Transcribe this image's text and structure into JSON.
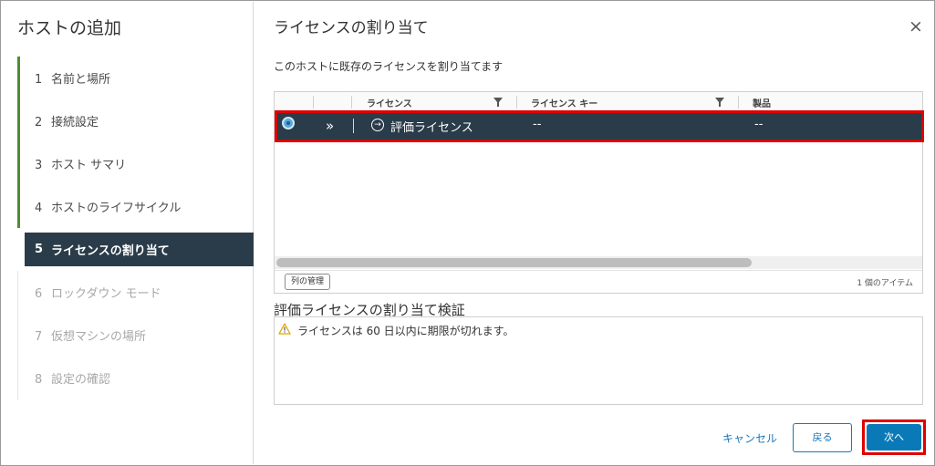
{
  "wizard": {
    "title": "ホストの追加",
    "steps": [
      {
        "num": "1",
        "label": "名前と場所",
        "state": "done"
      },
      {
        "num": "2",
        "label": "接続設定",
        "state": "done"
      },
      {
        "num": "3",
        "label": "ホスト サマリ",
        "state": "done"
      },
      {
        "num": "4",
        "label": "ホストのライフサイクル",
        "state": "done"
      },
      {
        "num": "5",
        "label": "ライセンスの割り当て",
        "state": "active"
      },
      {
        "num": "6",
        "label": "ロックダウン モード",
        "state": "pending"
      },
      {
        "num": "7",
        "label": "仮想マシンの場所",
        "state": "pending"
      },
      {
        "num": "8",
        "label": "設定の確認",
        "state": "pending"
      }
    ]
  },
  "page": {
    "title": "ライセンスの割り当て",
    "subtitle": "このホストに既存のライセンスを割り当てます",
    "close_icon": "close-icon"
  },
  "grid": {
    "columns": {
      "license": "ライセンス",
      "license_key": "ライセンス キー",
      "product": "製品"
    },
    "rows": [
      {
        "license": "評価ライセンス",
        "license_key": "--",
        "product": "--",
        "selected": true
      }
    ],
    "expand_glyph": "»",
    "arrow_glyph": "→",
    "column_manage_label": "列の管理",
    "item_count": "1 個のアイテム"
  },
  "validation": {
    "title": "評価ライセンスの割り当て検証",
    "message": "ライセンスは 60 日以内に期限が切れます。"
  },
  "footer": {
    "cancel_label": "キャンセル",
    "back_label": "戻る",
    "next_label": "次へ"
  },
  "colors": {
    "accent": "#0a79b8",
    "selected_row": "#2a3c49",
    "done_step": "#4b8f2e",
    "highlight": "#e00000",
    "warning": "#e0a800"
  }
}
